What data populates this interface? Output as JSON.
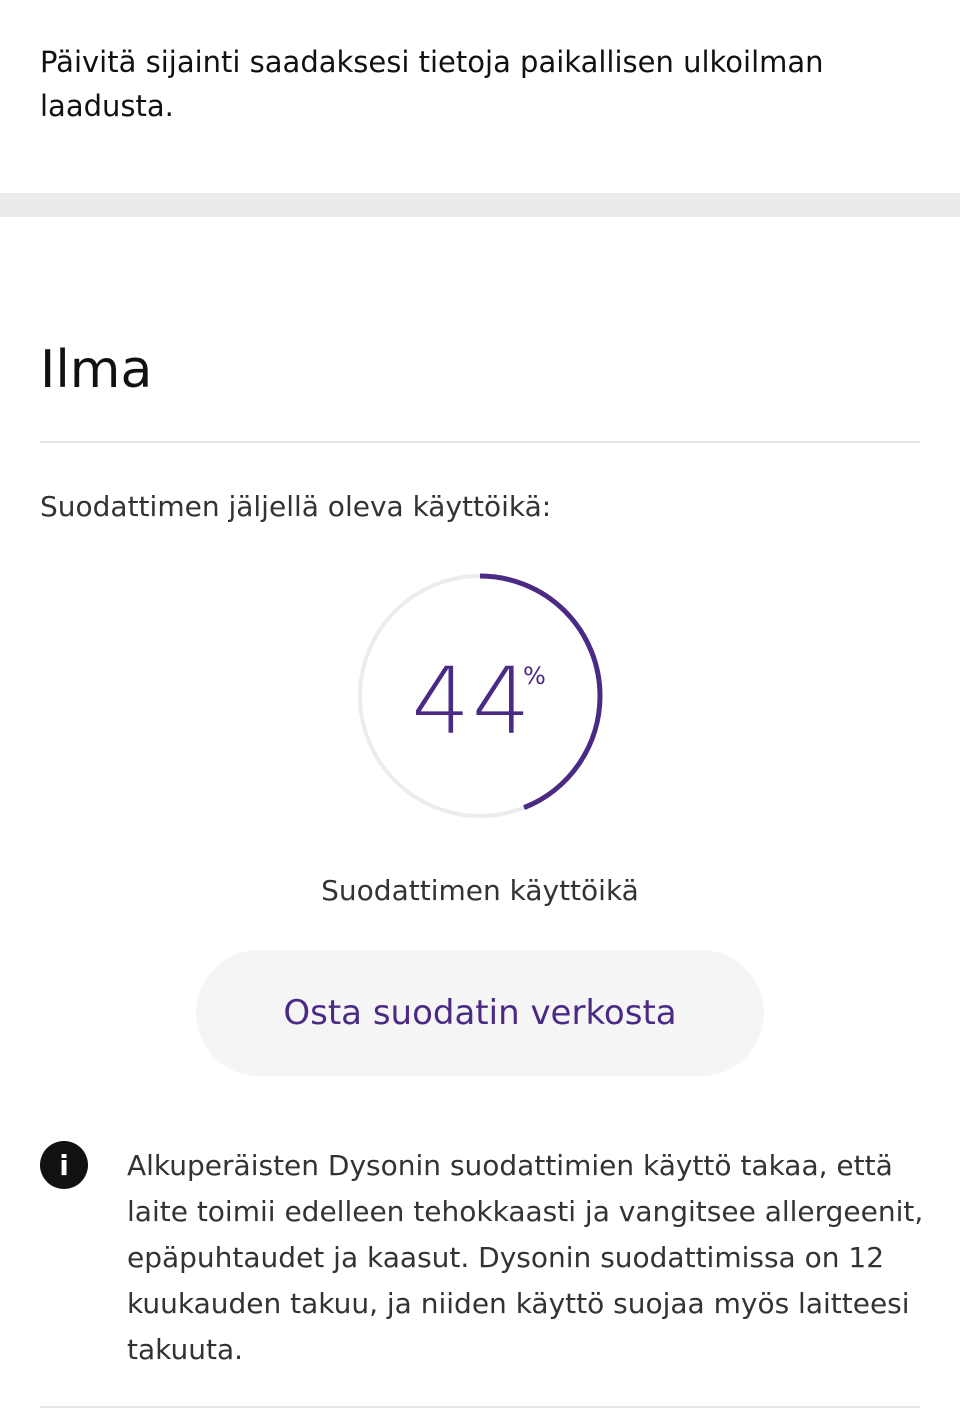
{
  "location": {
    "notice": "Päivitä sijainti saadaksesi tietoja paikallisen ulkoilman laadusta."
  },
  "air": {
    "title": "Ilma",
    "filter_label": "Suodattimen jäljellä oleva käyttöikä:",
    "filter_life": {
      "value": "44",
      "unit": "%",
      "fraction": 0.44,
      "caption": "Suodattimen käyttöikä",
      "color_progress": "#4b2a86",
      "color_track": "#ececec"
    },
    "buy_button_label": "Osta suodatin verkosta",
    "info": {
      "icon": "info-icon",
      "glyph": "i",
      "text": "Alkuperäisten Dysonin suodattimien käyttö takaa, että laite toimii edelleen tehokkaasti ja vangitsee allergeenit, epäpuhtaudet ja kaasut. Dysonin suodattimissa on 12 kuukauden takuu, ja niiden käyttö suojaa myös laitteesi takuuta."
    }
  }
}
